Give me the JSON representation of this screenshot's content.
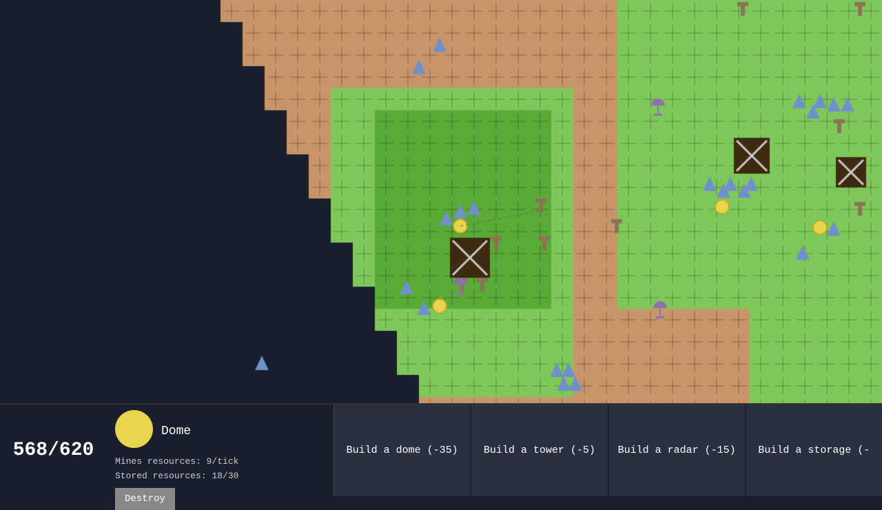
{
  "hud": {
    "resource_count": "568/620",
    "dome_icon_color": "#e8d44d",
    "dome_title": "Dome",
    "mines_resources": "Mines resources: 9/tick",
    "stored_resources": "Stored resources: 18/30",
    "destroy_label": "Destroy",
    "actions": [
      {
        "label": "Build a dome (-35)",
        "id": "build-dome"
      },
      {
        "label": "Build a tower (-5)",
        "id": "build-tower"
      },
      {
        "label": "Build a radar (-15)",
        "id": "build-radar"
      },
      {
        "label": "Build a storage (-",
        "id": "build-storage"
      }
    ]
  },
  "map": {
    "tile_size": 32,
    "dark_bg": "#1a1f2e"
  }
}
